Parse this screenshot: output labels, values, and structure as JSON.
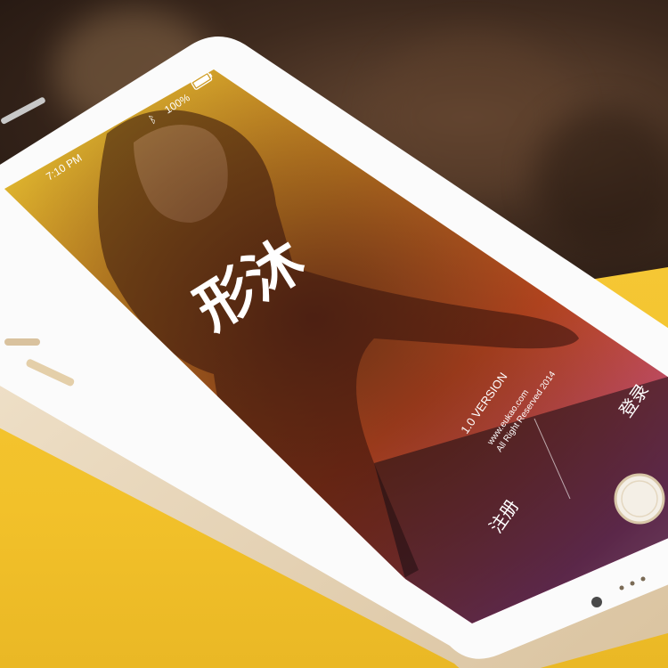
{
  "status_bar": {
    "time": "7:10 PM",
    "battery": "100%",
    "bluetooth_icon": "bluetooth-icon",
    "battery_icon": "battery-icon"
  },
  "app": {
    "logo_text": "形沐",
    "version": "1.0 VERSION",
    "website": "www.eukao.com",
    "copyright": "All Right Reserved 2014"
  },
  "buttons": {
    "login": "登录",
    "register": "注册"
  },
  "colors": {
    "background_yellow": "#f2c530",
    "phone_gold": "#e8d6b8",
    "gradient_start": "#f7d333",
    "gradient_mid": "#f06a22",
    "gradient_end": "#c24fa0"
  }
}
